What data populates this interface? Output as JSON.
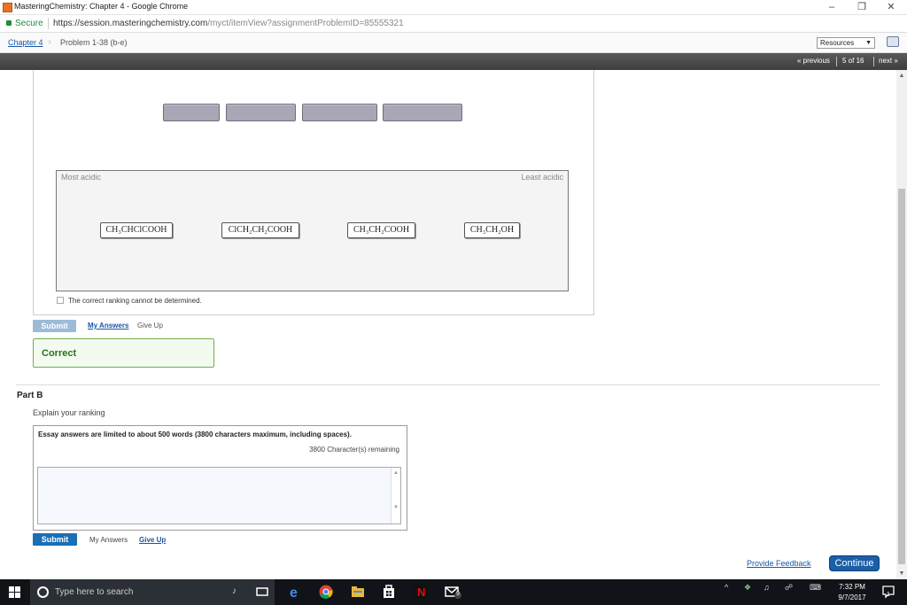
{
  "window": {
    "title": "MasteringChemistry: Chapter 4 - Google Chrome",
    "minimize": "–",
    "restore": "❐",
    "close": "✕"
  },
  "address": {
    "secure_label": "Secure",
    "url_host": "https://session.masteringchemistry.com",
    "url_path": "/myct/itemView?assignmentProblemID=85555321"
  },
  "breadcrumb": {
    "chapter": "Chapter 4",
    "problem": "Problem 1-38 (b-e)",
    "resources": "Resources"
  },
  "nav": {
    "previous": "« previous",
    "position": "5 of 16",
    "next": "next »"
  },
  "partA": {
    "most_acidic": "Most acidic",
    "least_acidic": "Least acidic",
    "compounds": [
      {
        "formula": "CH₃CHClCOOH"
      },
      {
        "formula": "ClCH₂CH₂COOH"
      },
      {
        "formula": "CH₃CH₂COOH"
      },
      {
        "formula": "CH₃CH₂OH"
      }
    ],
    "cannot_determine": "The correct ranking cannot be determined.",
    "submit": "Submit",
    "my_answers": "My Answers",
    "give_up": "Give Up",
    "result": "Correct"
  },
  "partB": {
    "title": "Part B",
    "prompt": "Explain your ranking",
    "essay_note": "Essay answers are limited to about 500 words (3800 characters maximum, including spaces).",
    "remaining": "3800 Character(s) remaining",
    "answer_value": "",
    "submit": "Submit",
    "my_answers": "My Answers",
    "give_up": "Give Up"
  },
  "footer": {
    "feedback": "Provide Feedback",
    "continue": "Continue"
  },
  "taskbar": {
    "search_placeholder": "Type here to search",
    "time": "7:32 PM",
    "date": "9/7/2017",
    "notification_count": "1",
    "mail_count": "9"
  },
  "colors": {
    "correct_border": "#6cb34a",
    "submit_active": "#1a6fb5",
    "submit_disabled": "#9cbbd8",
    "slot": "#a7a7b5",
    "link": "#1a56a8"
  }
}
